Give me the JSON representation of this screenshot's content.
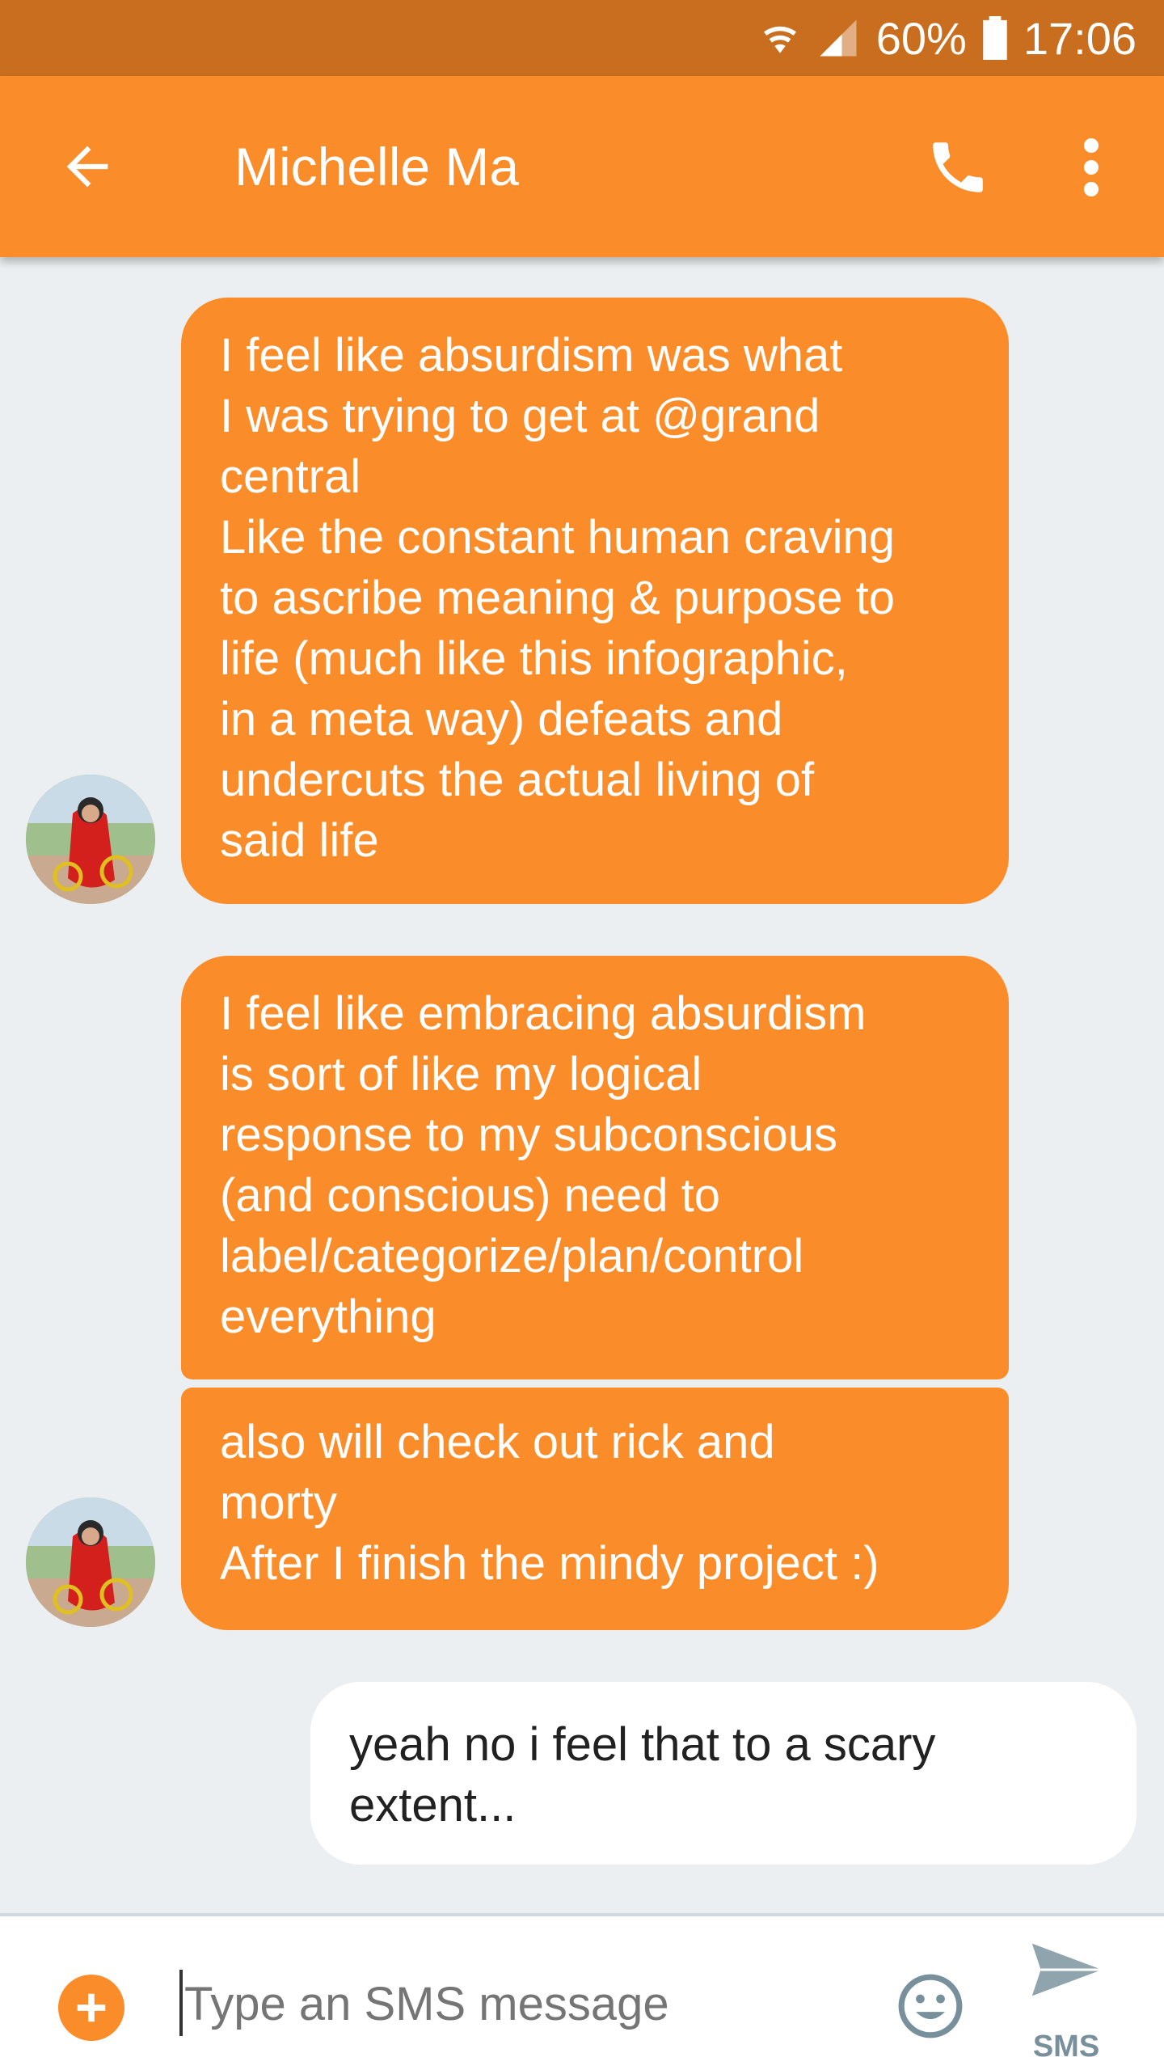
{
  "status_bar": {
    "battery": "60%",
    "time": "17:06"
  },
  "header": {
    "title": "Michelle Ma"
  },
  "messages": [
    {
      "text": "I feel like absurdism was what\nI was trying to get at @grand\ncentral\nLike the constant human craving\nto ascribe meaning & purpose to\nlife (much like this infographic,\nin a meta way) defeats and\nundercuts the actual living of\nsaid life"
    },
    {
      "text": "I feel like embracing absurdism\nis sort of like my logical\nresponse to my subconscious\n(and conscious) need to\nlabel/categorize/plan/control\neverything"
    },
    {
      "text": "also will check out rick and\nmorty\nAfter I finish the mindy project :)"
    },
    {
      "text": "yeah no i feel that to a scary\nextent..."
    }
  ],
  "composer": {
    "placeholder": "Type an SMS message",
    "send_label": "SMS"
  },
  "colors": {
    "accent": "#fa8c2a",
    "status_bar": "#c86e1e",
    "background": "#eceff1",
    "outgoing_bubble": "#ffffff"
  },
  "icons": [
    "wifi-icon",
    "signal-icon",
    "battery-icon",
    "back-arrow-icon",
    "phone-icon",
    "more-vert-icon",
    "add-icon",
    "emoji-icon",
    "send-icon"
  ]
}
